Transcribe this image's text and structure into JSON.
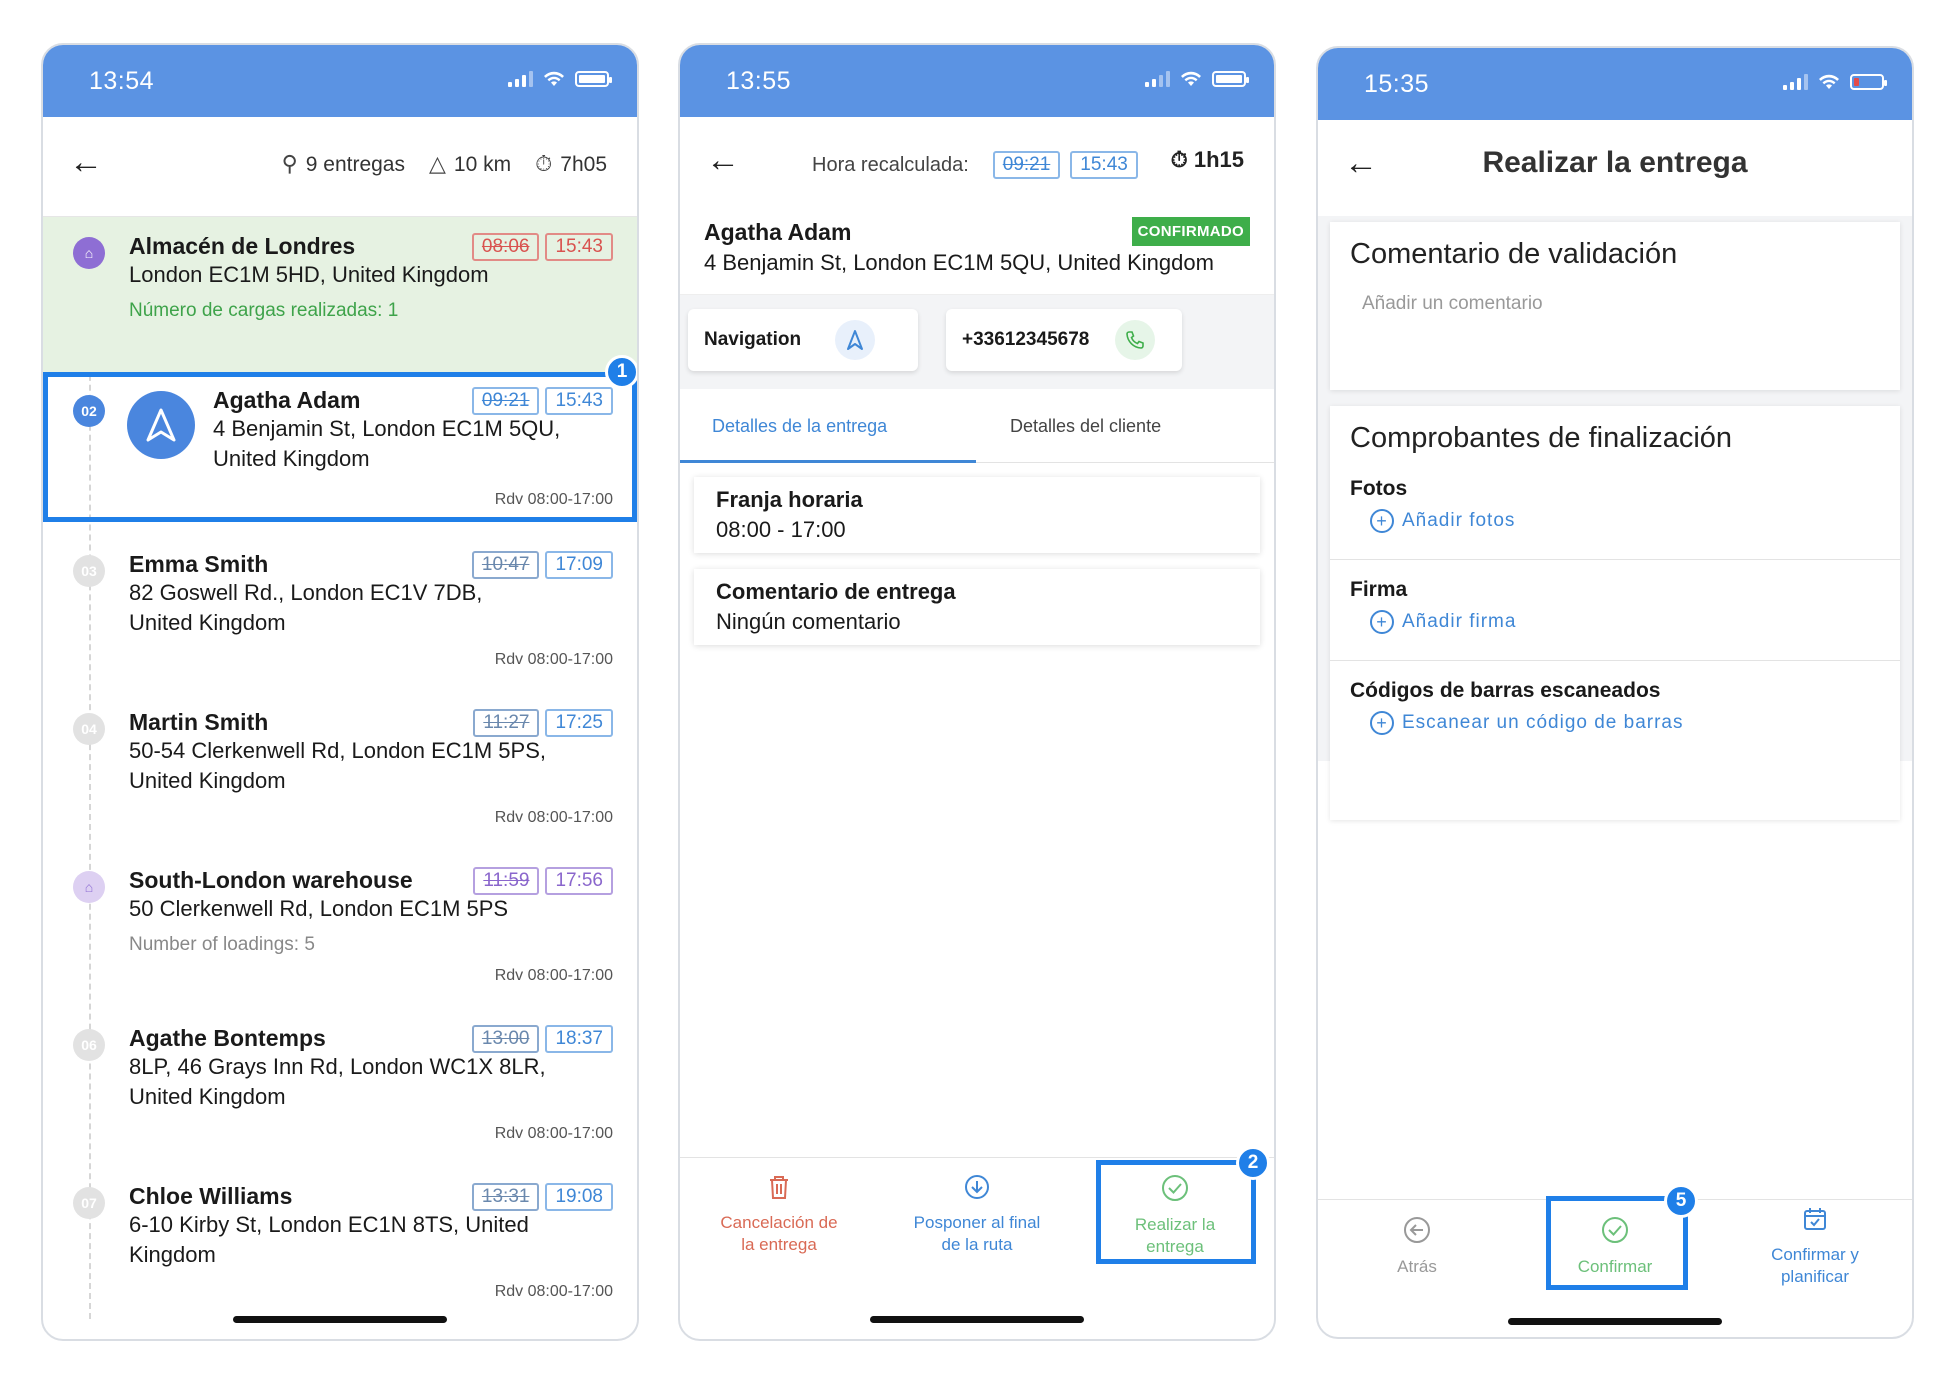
{
  "phone1": {
    "status_time": "13:54",
    "stats": {
      "deliveries": "9 entregas",
      "distance": "10 km",
      "duration": "7h05"
    },
    "stops": [
      {
        "badge": "",
        "name": "Almacén de Londres",
        "address": "London EC1M 5HD, United Kingdom",
        "loads": "Número de cargas realizadas: 1",
        "time_old": "08:06",
        "time_new": "15:43",
        "rdv": ""
      },
      {
        "badge": "02",
        "name": "Agatha Adam",
        "address": "4 Benjamin St, London EC1M 5QU, United Kingdom",
        "time_old": "09:21",
        "time_new": "15:43",
        "rdv": "Rdv 08:00-17:00"
      },
      {
        "badge": "03",
        "name": "Emma Smith",
        "address": "82 Goswell Rd., London EC1V 7DB, United Kingdom",
        "time_old": "10:47",
        "time_new": "17:09",
        "rdv": "Rdv 08:00-17:00"
      },
      {
        "badge": "04",
        "name": "Martin Smith",
        "address": "50-54 Clerkenwell Rd, London EC1M 5PS, United Kingdom",
        "time_old": "11:27",
        "time_new": "17:25",
        "rdv": "Rdv 08:00-17:00"
      },
      {
        "badge": "",
        "name": "South-London warehouse",
        "address": "50 Clerkenwell Rd, London EC1M 5PS",
        "loads": "Number of loadings: 5",
        "time_old": "11:59",
        "time_new": "17:56",
        "rdv": "Rdv 08:00-17:00"
      },
      {
        "badge": "06",
        "name": "Agathe Bontemps",
        "address": "8LP, 46 Grays Inn Rd, London WC1X 8LR, United Kingdom",
        "time_old": "13:00",
        "time_new": "18:37",
        "rdv": "Rdv 08:00-17:00"
      },
      {
        "badge": "07",
        "name": "Chloe Williams",
        "address": "6-10 Kirby St, London EC1N 8TS, United Kingdom",
        "time_old": "13:31",
        "time_new": "19:08",
        "rdv": "Rdv 08:00-17:00"
      }
    ],
    "callout": "1"
  },
  "phone2": {
    "status_time": "13:55",
    "recalc_label": "Hora recalculada:",
    "time_old": "09:21",
    "time_new": "15:43",
    "duration": "1h15",
    "client_name": "Agatha Adam",
    "client_address": "4 Benjamin St, London EC1M 5QU, United Kingdom",
    "status_badge": "CONFIRMADO",
    "nav_label": "Navigation",
    "phone_number": "+33612345678",
    "tabs": [
      "Detalles de la entrega",
      "Detalles del cliente"
    ],
    "cards": [
      {
        "title": "Franja horaria",
        "value": "08:00 - 17:00"
      },
      {
        "title": "Comentario de entrega",
        "value": "Ningún comentario"
      }
    ],
    "bottom": [
      {
        "label1": "Cancelación de",
        "label2": "la entrega"
      },
      {
        "label1": "Posponer al final",
        "label2": "de la ruta"
      },
      {
        "label1": "Realizar la",
        "label2": "entrega"
      }
    ],
    "callout": "2"
  },
  "phone3": {
    "status_time": "15:35",
    "title": "Realizar la entrega",
    "validation_title": "Comentario de validación",
    "comment_placeholder": "Añadir un comentario",
    "proofs_title": "Comprobantes de finalización",
    "photos_label": "Fotos",
    "photos_link": "Añadir fotos",
    "signature_label": "Firma",
    "signature_link": "Añadir firma",
    "barcodes_label": "Códigos de barras escaneados",
    "barcodes_link": "Escanear un código de barras",
    "bottom": {
      "back": "Atrás",
      "confirm": "Confirmar",
      "confirm_plan1": "Confirmar y",
      "confirm_plan2": "planificar"
    },
    "callout": "5"
  },
  "colors": {
    "header_blue": "#5b93e3",
    "accent_blue": "#1f7fe8",
    "confirmed_green": "#3eae4a",
    "cancel_red": "#d9534f"
  }
}
